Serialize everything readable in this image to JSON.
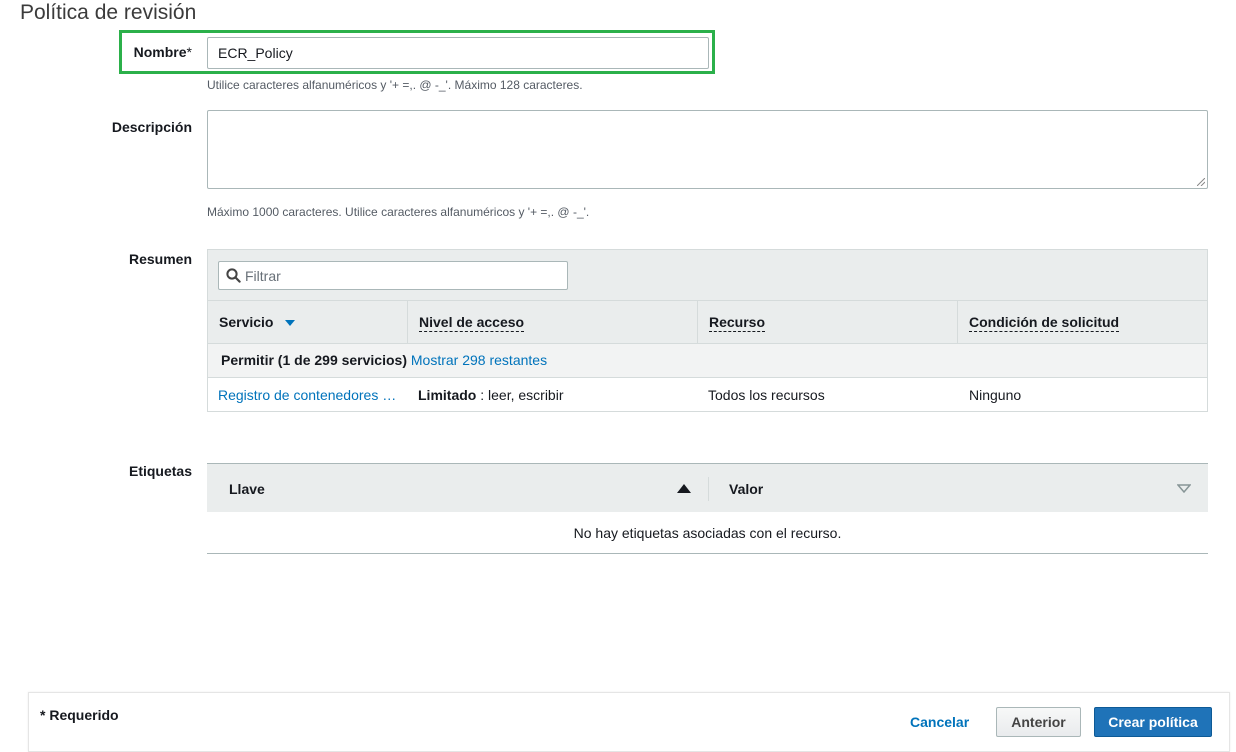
{
  "page_title": "Política de revisión",
  "name": {
    "label": "Nombre",
    "required_mark": "*",
    "value": "ECR_Policy",
    "hint": "Utilice caracteres alfanuméricos y '+ =,. @ -_'. Máximo 128 caracteres."
  },
  "description": {
    "label": "Descripción",
    "value": "",
    "hint": "Máximo 1000 caracteres. Utilice caracteres alfanuméricos y '+ =,. @ -_'."
  },
  "summary": {
    "label": "Resumen",
    "filter_placeholder": "Filtrar",
    "columns": [
      "Servicio",
      "Nivel de acceso",
      "Recurso",
      "Condición de solicitud"
    ],
    "group": {
      "title": "Permitir (1 de 299 servicios)",
      "link": "Mostrar 298 restantes"
    },
    "rows": [
      {
        "service": "Registro de contenedores …",
        "access_level": "Limitado",
        "access_detail": ": leer, escribir",
        "resource": "Todos los recursos",
        "condition": "Ninguno"
      }
    ]
  },
  "tags": {
    "label": "Etiquetas",
    "columns": [
      "Llave",
      "Valor"
    ],
    "empty_message": "No hay etiquetas asociadas con el recurso."
  },
  "footer": {
    "required_note": "* Requerido",
    "cancel_label": "Cancelar",
    "previous_label": "Anterior",
    "create_label": "Crear política"
  },
  "colors": {
    "highlight": "#2bb04a",
    "link": "#0073bb",
    "primary_button": "#1f73b8",
    "table_header": "#eaeded"
  }
}
